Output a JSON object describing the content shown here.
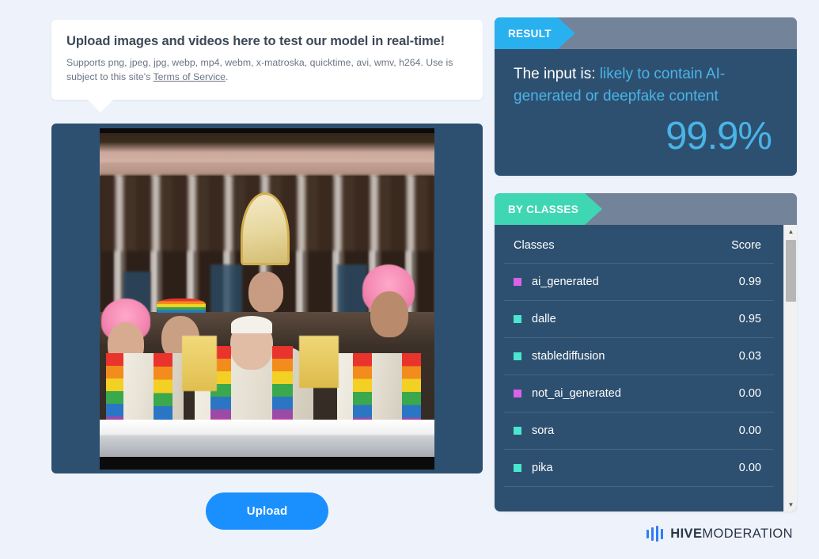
{
  "info_card": {
    "title": "Upload images and videos here to test our model in real-time!",
    "supports_prefix": "Supports png, jpeg, jpg, webp, mp4, webm, x-matroska, quicktime, avi, wmv, h264. Use is subject to this site's ",
    "terms_link": "Terms of Service",
    "supports_suffix": "."
  },
  "upload": {
    "button_label": "Upload"
  },
  "preview": {
    "alt": "AI-generated image of the Pope wearing a white robe with a rainbow stole, surrounded by people with pink hair and rainbow vestments in front of a classical basilica facade"
  },
  "result_panel": {
    "tab_label": "RESULT",
    "prefix": "The input is:",
    "verdict": "likely to contain AI-generated or deepfake content",
    "percentage": "99.9%"
  },
  "classes_panel": {
    "tab_label": "BY CLASSES",
    "col_classes": "Classes",
    "col_score": "Score",
    "rows": [
      {
        "label": "ai_generated",
        "score": "0.99",
        "color": "#d863e8"
      },
      {
        "label": "dalle",
        "score": "0.95",
        "color": "#49e6d0"
      },
      {
        "label": "stablediffusion",
        "score": "0.03",
        "color": "#49e6d0"
      },
      {
        "label": "not_ai_generated",
        "score": "0.00",
        "color": "#d863e8"
      },
      {
        "label": "sora",
        "score": "0.00",
        "color": "#49e6d0"
      },
      {
        "label": "pika",
        "score": "0.00",
        "color": "#49e6d0"
      }
    ],
    "scroll_up_icon": "▲",
    "scroll_down_icon": "▼"
  },
  "footer": {
    "logo_bold": "HIVE",
    "logo_light": "MODERATION"
  },
  "colors": {
    "page_bg": "#eef3fb",
    "panel_bg": "#2e5070",
    "panel_head_bg": "#72839a",
    "result_tab": "#29b0ef",
    "classes_tab": "#3fd6b4",
    "accent_blue": "#49b4e8",
    "upload_blue": "#1a90ff"
  }
}
